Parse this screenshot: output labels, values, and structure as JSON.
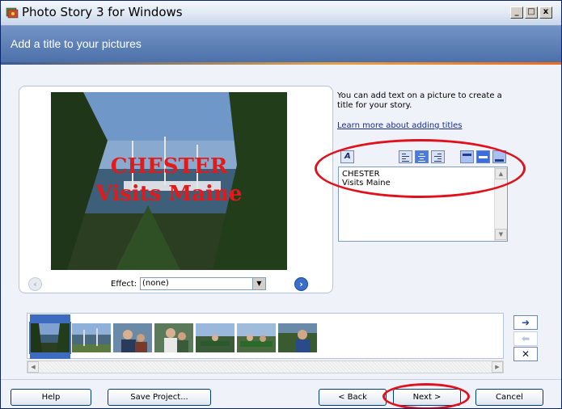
{
  "window": {
    "title": "Photo Story 3 for Windows",
    "controls": {
      "minimize": "_",
      "maximize": "□",
      "close": "x"
    }
  },
  "header": {
    "title": "Add a title to your pictures"
  },
  "preview": {
    "overlay_line1": "CHESTER",
    "overlay_line2": "Visits Maine",
    "effect_label": "Effect:",
    "effect_value": "(none)"
  },
  "side": {
    "info": "You can add text on a picture to create a title for your story.",
    "learn_more": "Learn more about adding titles",
    "text_line1": "CHESTER",
    "text_line2": "Visits Maine"
  },
  "filmstrip": {
    "thumb_count": 7,
    "selected_index": 0
  },
  "buttons": {
    "help": "Help",
    "save_project": "Save Project...",
    "back": "< Back",
    "next": "Next >",
    "cancel": "Cancel"
  },
  "colors": {
    "accent": "#3d6bc0",
    "annotation": "#e0101c",
    "title_text": "#e21a1a"
  },
  "icons": {
    "move_right": "right-arrow-icon",
    "move_left": "left-arrow-icon",
    "remove": "x-icon"
  }
}
